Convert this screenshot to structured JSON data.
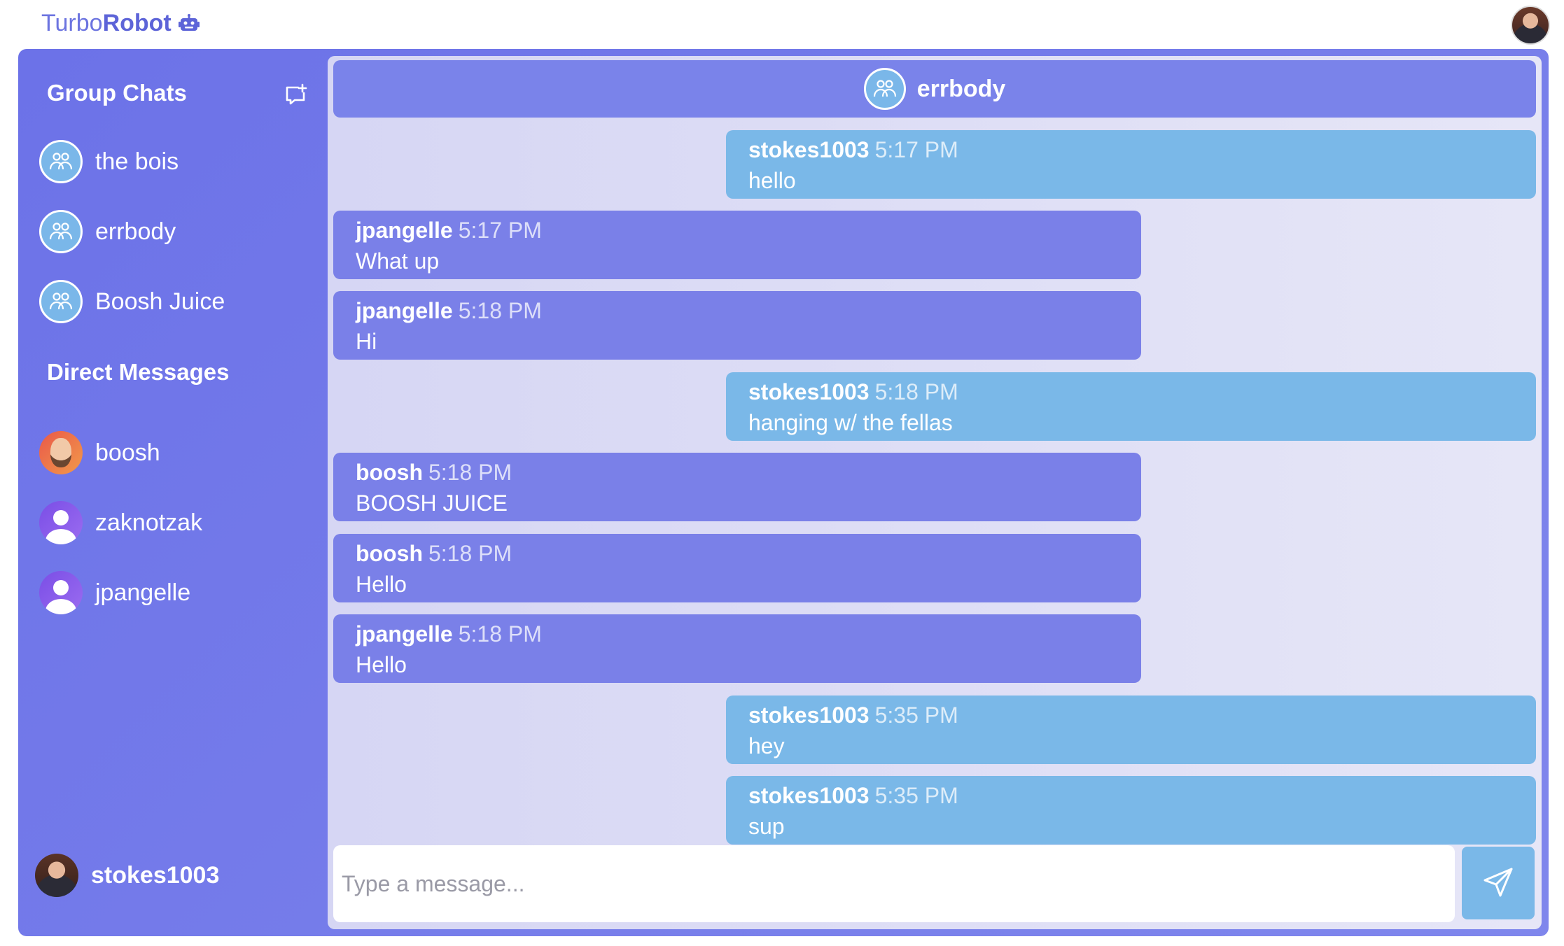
{
  "brand": {
    "light": "Turbo",
    "bold": "Robot",
    "icon": "robot-icon"
  },
  "colors": {
    "accent": "#6c72e8",
    "header": "#7a83ea",
    "own_message": "#7ab8e8",
    "other_message": "#7a80e8"
  },
  "sidebar": {
    "group_title": "Group Chats",
    "new_chat_icon": "new-chat-icon",
    "groups": [
      {
        "label": "the bois"
      },
      {
        "label": "errbody"
      },
      {
        "label": "Boosh Juice"
      }
    ],
    "dm_title": "Direct Messages",
    "dms": [
      {
        "label": "boosh"
      },
      {
        "label": "zaknotzak"
      },
      {
        "label": "jpangelle"
      }
    ],
    "current_user": "stokes1003"
  },
  "chat": {
    "title": "errbody",
    "messages": [
      {
        "user": "stokes1003",
        "time": "5:17 PM",
        "text": "hello",
        "side": "right"
      },
      {
        "user": "jpangelle",
        "time": "5:17 PM",
        "text": "What up",
        "side": "left"
      },
      {
        "user": "jpangelle",
        "time": "5:18 PM",
        "text": "Hi",
        "side": "left"
      },
      {
        "user": "stokes1003",
        "time": "5:18 PM",
        "text": "hanging w/ the fellas",
        "side": "right"
      },
      {
        "user": "boosh",
        "time": "5:18 PM",
        "text": "BOOSH JUICE",
        "side": "left"
      },
      {
        "user": "boosh",
        "time": "5:18 PM",
        "text": "Hello",
        "side": "left"
      },
      {
        "user": "jpangelle",
        "time": "5:18 PM",
        "text": "Hello",
        "side": "left"
      },
      {
        "user": "stokes1003",
        "time": "5:35 PM",
        "text": "hey",
        "side": "right"
      },
      {
        "user": "stokes1003",
        "time": "5:35 PM",
        "text": "sup",
        "side": "right"
      }
    ],
    "input_placeholder": "Type a message...",
    "send_icon": "send-icon"
  }
}
